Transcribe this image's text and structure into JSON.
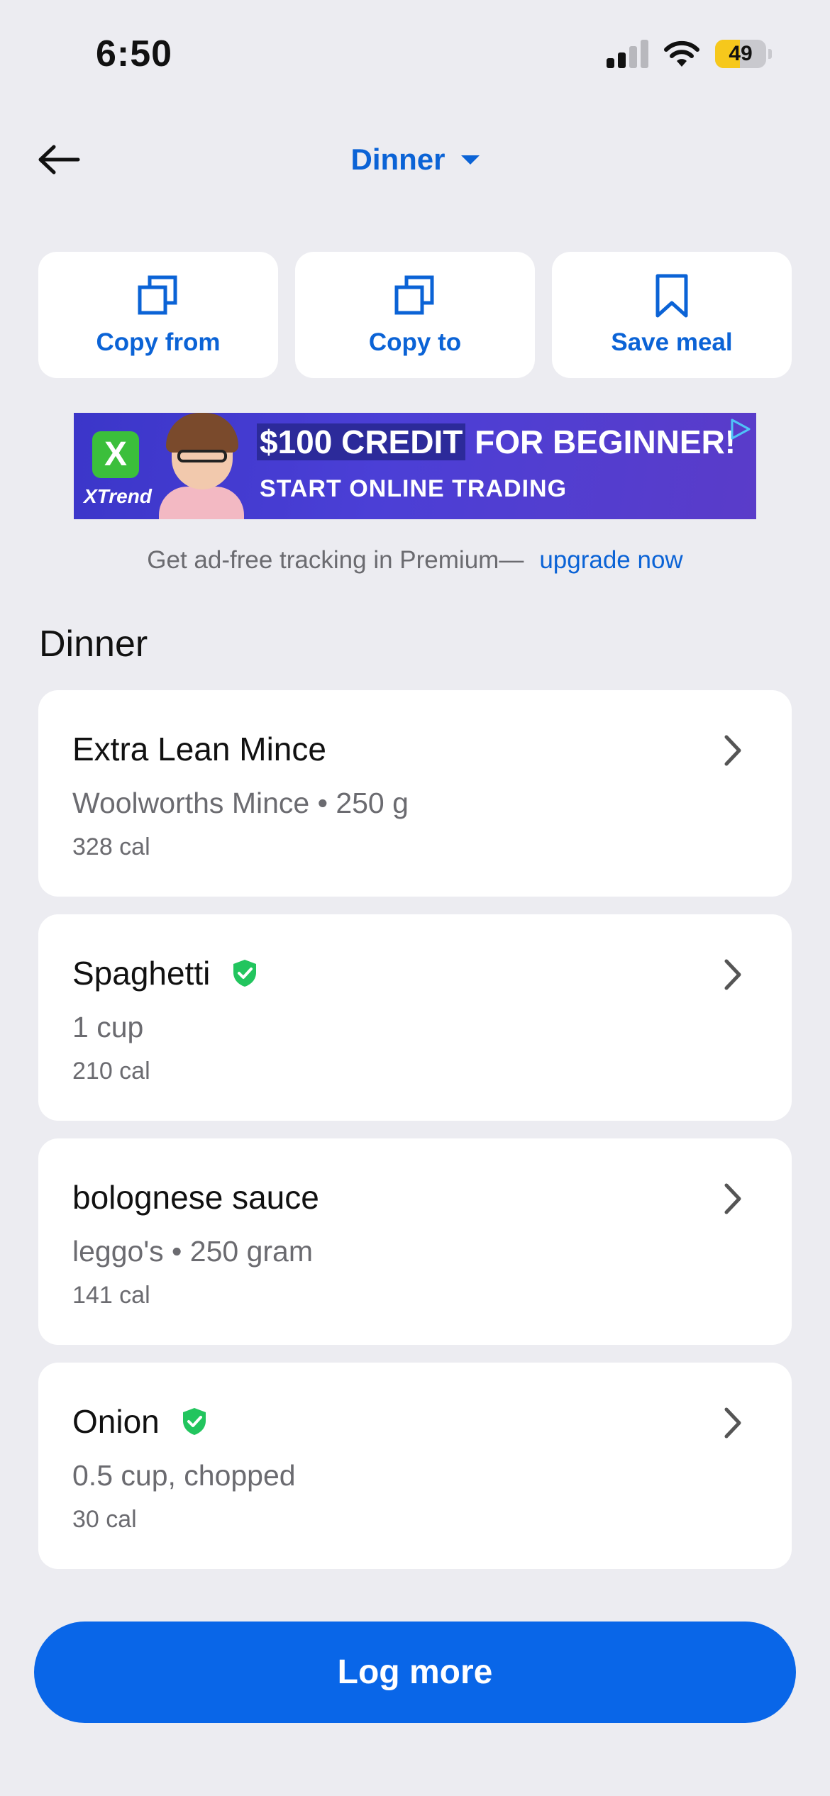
{
  "status_bar": {
    "time": "6:50",
    "battery": "49",
    "battery_level": 0.49
  },
  "header": {
    "meal_label": "Dinner"
  },
  "actions": [
    {
      "label": "Copy from",
      "icon": "copy-icon"
    },
    {
      "label": "Copy to",
      "icon": "copy-icon"
    },
    {
      "label": "Save meal",
      "icon": "bookmark-icon"
    }
  ],
  "ad": {
    "brand": "XTrend",
    "logo": "X",
    "headline_highlight": "$100 CREDIT",
    "headline_rest": "FOR BEGINNER!",
    "subline": "START ONLINE TRADING"
  },
  "premium": {
    "text": "Get ad-free tracking in Premium—",
    "link": "upgrade now"
  },
  "section_title": "Dinner",
  "foods": [
    {
      "name": "Extra Lean Mince",
      "detail": "Woolworths Mince • 250 g",
      "calories": "328 cal",
      "verified": false
    },
    {
      "name": "Spaghetti",
      "detail": "1 cup",
      "calories": "210 cal",
      "verified": true
    },
    {
      "name": "bolognese sauce",
      "detail": "leggo's • 250 gram",
      "calories": "141 cal",
      "verified": false
    },
    {
      "name": "Onion",
      "detail": "0.5 cup, chopped",
      "calories": "30 cal",
      "verified": true
    }
  ],
  "log_more_label": "Log more",
  "colors": {
    "accent": "#0b63d6",
    "button": "#0966e8",
    "verified": "#22c55e",
    "background": "#ececf1"
  }
}
